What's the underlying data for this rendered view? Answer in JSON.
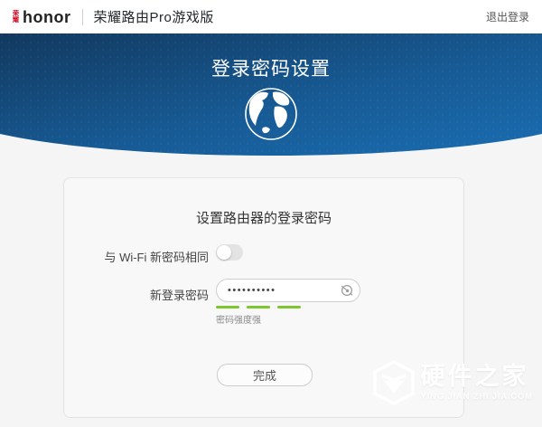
{
  "topbar": {
    "brand_cn": "荣耀",
    "brand": "honor",
    "product": "荣耀路由Pro游戏版",
    "logout": "退出登录"
  },
  "hero": {
    "title": "登录密码设置",
    "icon": "globe-icon",
    "bg_gradient_top": "#12395f",
    "bg_gradient_bottom": "#1a6db2"
  },
  "card": {
    "heading": "设置路由器的登录密码",
    "toggle_row": {
      "label": "与 Wi-Fi 新密码相同",
      "state": "off"
    },
    "password_row": {
      "label": "新登录密码",
      "value": "••••••••••",
      "visibility_icon": "eye-off-icon"
    },
    "strength": {
      "bars": 3,
      "color": "#7ec62f",
      "text": "密码强度强"
    },
    "submit_label": "完成"
  },
  "watermark": {
    "logo_icon": "hexagon-box-logo-icon",
    "title": "硬件之家",
    "subtitle": "YING JIAN ZHI JIA.COM"
  }
}
